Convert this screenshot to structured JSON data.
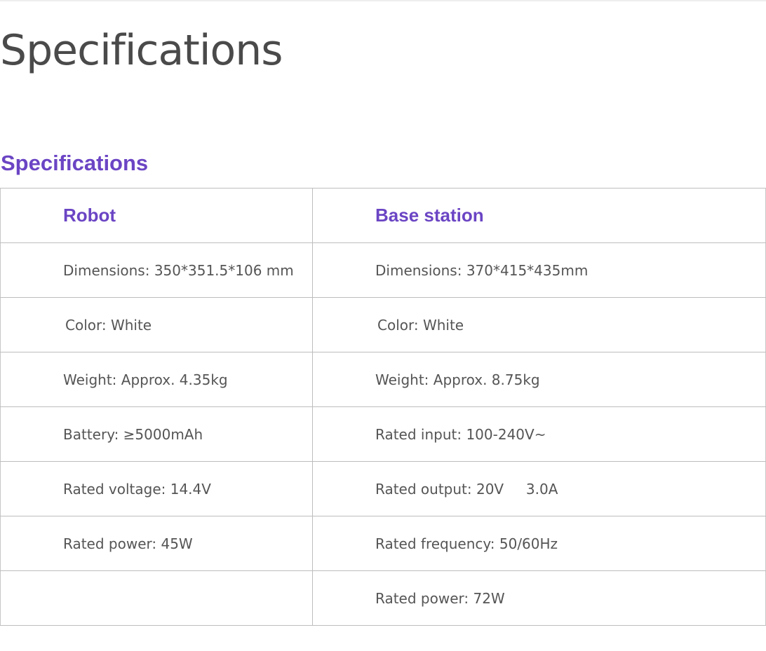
{
  "page": {
    "title": "Specifications"
  },
  "section": {
    "title": "Specifications"
  },
  "table": {
    "headers": {
      "robot": "Robot",
      "base": "Base station"
    },
    "rows": [
      {
        "robot": "Dimensions: 350*351.5*106 mm",
        "base": "Dimensions: 370*415*435mm"
      },
      {
        "robot": "Color: White",
        "base": "Color: White"
      },
      {
        "robot": "Weight: Approx. 4.35kg",
        "base": "Weight: Approx. 8.75kg"
      },
      {
        "robot": "Battery: ≥5000mAh",
        "base": "Rated input: 100-240V~"
      },
      {
        "robot": "Rated voltage: 14.4V",
        "base": "Rated output: 20V     3.0A"
      },
      {
        "robot": "Rated power: 45W",
        "base": "Rated frequency: 50/60Hz"
      },
      {
        "robot": "",
        "base": "Rated power: 72W"
      }
    ]
  },
  "colors": {
    "accent": "#6b45c4",
    "title_text": "#4a4a4a",
    "body_text": "#555555",
    "border": "#bdbdbd"
  }
}
